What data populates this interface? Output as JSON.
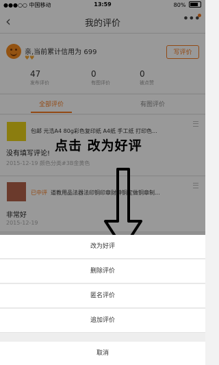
{
  "status_bar": {
    "carrier": "●●●○○ 中国移动",
    "time": "13:59",
    "battery_text": "80%"
  },
  "nav": {
    "back_glyph": "‹",
    "title": "我的评价",
    "more_glyph": "•••"
  },
  "profile": {
    "credit_text": "亲,当前累计信用为 699",
    "hearts": "♥♥",
    "write_button": "写评价",
    "stats": [
      {
        "value": "47",
        "label": "发布评价"
      },
      {
        "value": "0",
        "label": "有图评价"
      },
      {
        "value": "0",
        "label": "被点赞"
      }
    ]
  },
  "tabs": {
    "all": "全部评价",
    "with_images": "有图评价"
  },
  "reviews": [
    {
      "product_title": "包邮 元浩A4 80g彩色复印纸 A4纸 手工纸 打印色...",
      "rating_label": "",
      "comment": "没有填写评论!",
      "meta": "2015-12-19  颜色分类#3B金黄色",
      "thumb_color": "#e8d11a"
    },
    {
      "product_title": "道教用品法器法印铜印章财神铜定做铜章制...",
      "rating_label": "已中评",
      "comment": "非常好",
      "meta": "2015-12-19",
      "thumb_color": "#b2624a"
    }
  ],
  "annotation": {
    "text": "点击 改为好评"
  },
  "action_sheet": {
    "options": [
      "改为好评",
      "删除评价",
      "匿名评价",
      "追加评价"
    ],
    "cancel": "取消"
  },
  "colors": {
    "accent": "#f47a20",
    "overlay": "rgba(0,0,0,0.4)"
  }
}
